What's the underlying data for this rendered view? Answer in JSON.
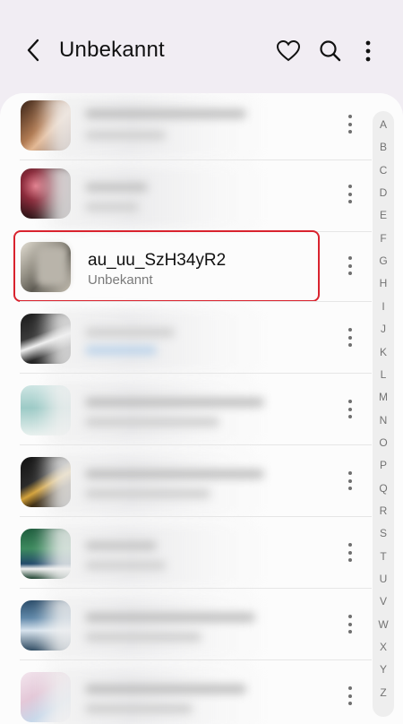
{
  "header": {
    "title": "Unbekannt",
    "back_icon": "back-arrow-icon",
    "favorite_icon": "heart-icon",
    "search_icon": "search-icon",
    "more_icon": "more-vert-icon"
  },
  "list": {
    "selected_item": {
      "title": "au_uu_SzH34yR2",
      "subtitle": "Unbekannt"
    },
    "item_more_icon": "more-vert-icon"
  },
  "index_letters": [
    "A",
    "B",
    "C",
    "D",
    "E",
    "F",
    "G",
    "H",
    "I",
    "J",
    "K",
    "L",
    "M",
    "N",
    "O",
    "P",
    "Q",
    "R",
    "S",
    "T",
    "U",
    "V",
    "W",
    "X",
    "Y",
    "Z"
  ],
  "colors": {
    "background": "#f1edf3",
    "panel": "#fcfcfc",
    "highlight": "#d9232e"
  }
}
